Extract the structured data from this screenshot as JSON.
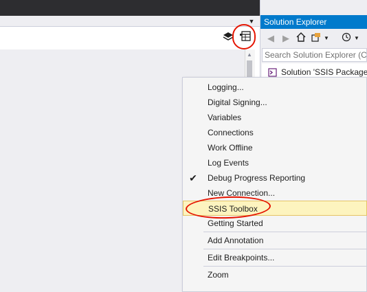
{
  "solution_explorer": {
    "title": "Solution Explorer",
    "search_placeholder": "Search Solution Explorer (Ct",
    "solution_label": "Solution 'SSIS Package",
    "toolbar_icons": [
      "back-icon",
      "forward-icon",
      "home-icon",
      "sync-icon",
      "dropdown-icon",
      "history-icon",
      "dropdown-icon"
    ]
  },
  "context_menu": {
    "items": [
      {
        "label": "Logging...",
        "checked": false
      },
      {
        "label": "Digital Signing...",
        "checked": false
      },
      {
        "label": "Variables",
        "checked": false
      },
      {
        "label": "Connections",
        "checked": false
      },
      {
        "label": "Work Offline",
        "checked": false
      },
      {
        "label": "Log Events",
        "checked": false
      },
      {
        "label": "Debug Progress Reporting",
        "checked": true,
        "check_glyph": "✔"
      },
      {
        "label": "New Connection...",
        "checked": false
      },
      {
        "label": "SSIS Toolbox",
        "checked": false,
        "highlighted": true
      },
      {
        "label": "Getting Started",
        "checked": false
      },
      {
        "label": "Add Annotation",
        "checked": false
      },
      {
        "label": "Edit Breakpoints...",
        "checked": false
      },
      {
        "label": "Zoom",
        "checked": false
      }
    ]
  },
  "colors": {
    "accent": "#007acc",
    "highlight": "#fdf4bf",
    "annotation": "#e51400"
  }
}
